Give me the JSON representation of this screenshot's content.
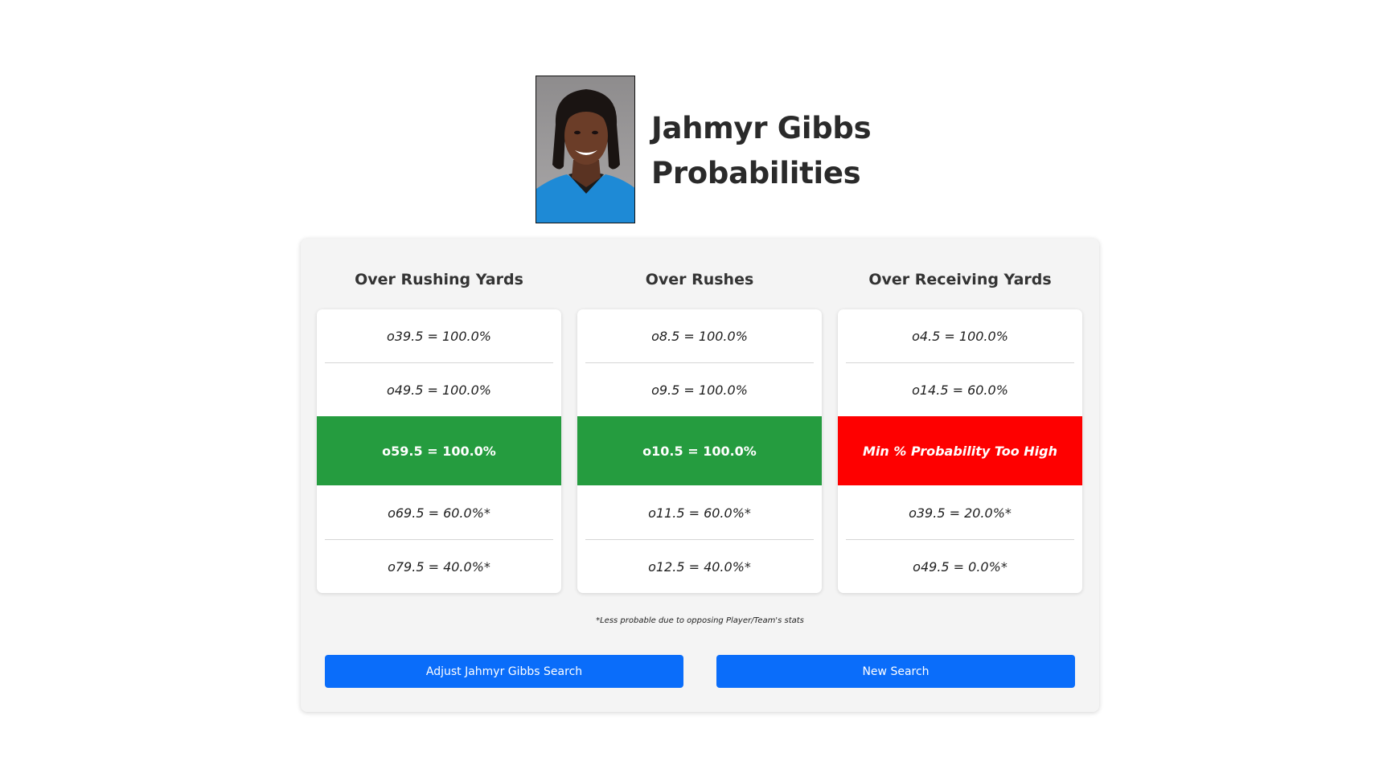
{
  "player": {
    "name_line": "Jahmyr Gibbs",
    "subtitle_line": "Probabilities"
  },
  "columns": [
    {
      "header": "Over Rushing Yards",
      "rows": [
        "o39.5 = 100.0%",
        "o49.5 = 100.0%",
        "o59.5 = 100.0%",
        "o69.5 = 60.0%*",
        "o79.5 = 40.0%*"
      ],
      "highlight_status": "selected"
    },
    {
      "header": "Over Rushes",
      "rows": [
        "o8.5 = 100.0%",
        "o9.5 = 100.0%",
        "o10.5 = 100.0%",
        "o11.5 = 60.0%*",
        "o12.5 = 40.0%*"
      ],
      "highlight_status": "selected"
    },
    {
      "header": "Over Receiving Yards",
      "rows": [
        "o4.5 = 100.0%",
        "o14.5 = 60.0%",
        "Min % Probability Too High",
        "o39.5 = 20.0%*",
        "o49.5 = 0.0%*"
      ],
      "highlight_status": "error"
    }
  ],
  "colors": {
    "selected": "#259c3f",
    "error": "#fe0000",
    "button": "#0a6dfa"
  },
  "footnote": "*Less probable due to opposing Player/Team's stats",
  "buttons": {
    "adjust": "Adjust Jahmyr Gibbs Search",
    "new_search": "New Search"
  }
}
